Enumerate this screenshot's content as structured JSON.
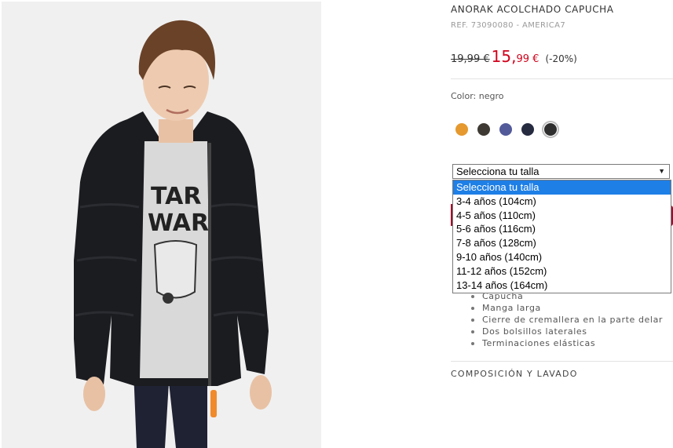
{
  "product": {
    "title": "ANORAK ACOLCHADO CAPUCHA",
    "ref": "REF. 73090080 - AMERICA7",
    "old_price": "19,99 €",
    "new_price_int": "15,",
    "new_price_dec": "99 €",
    "discount": "(-20%)",
    "color_label": "Color: negro",
    "image_alt": "Niño con anorak acolchado negro"
  },
  "swatches": [
    {
      "name": "naranja",
      "color": "#e5992e"
    },
    {
      "name": "marrón oscuro",
      "color": "#3e3a33"
    },
    {
      "name": "azul",
      "color": "#525a9a"
    },
    {
      "name": "marino",
      "color": "#262b40"
    },
    {
      "name": "negro",
      "color": "#2f2f2f",
      "selected": true
    }
  ],
  "size_select": {
    "value": "Selecciona tu talla",
    "options": [
      "Selecciona tu talla",
      "3-4 años (104cm)",
      "4-5 años (110cm)",
      "5-6 años (116cm)",
      "7-8 años (128cm)",
      "9-10 años (140cm)",
      "11-12 años (152cm)",
      "13-14 años (164cm)"
    ]
  },
  "features": [
    "Capucha",
    "Manga larga",
    "Cierre de cremallera en la parte delar",
    "Dos bolsillos laterales",
    "Terminaciones elásticas"
  ],
  "composition_label": "COMPOSICIÓN Y LAVADO"
}
